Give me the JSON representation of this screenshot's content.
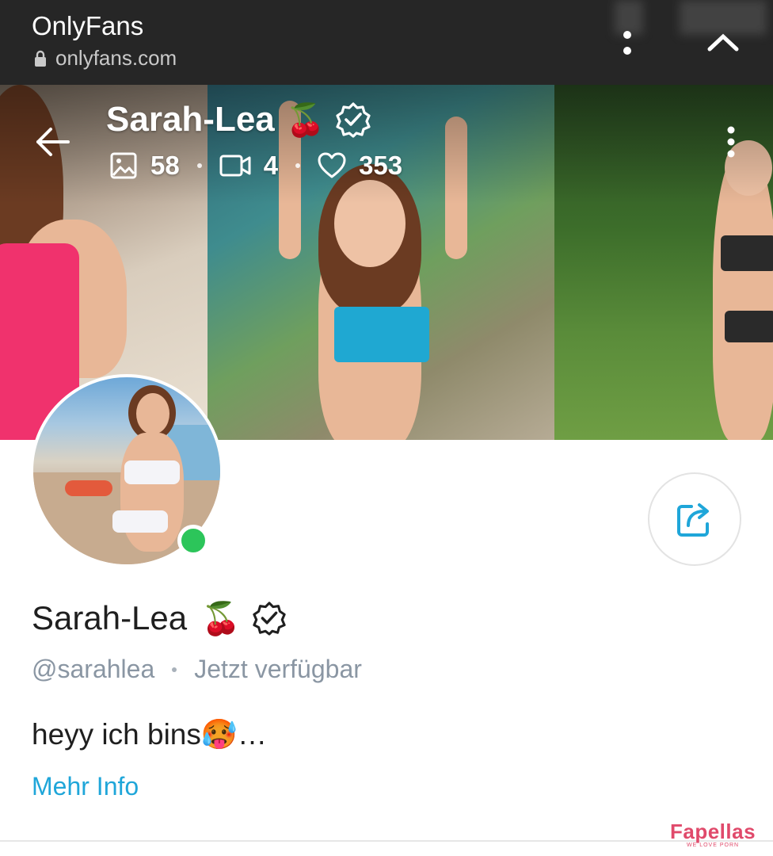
{
  "browser": {
    "title": "OnlyFans",
    "url": "onlyfans.com"
  },
  "cover": {
    "name": "Sarah-Lea",
    "emoji": "🍒",
    "stats": {
      "photos": "58",
      "videos": "4",
      "likes": "353"
    }
  },
  "profile": {
    "name": "Sarah-Lea",
    "emoji": "🍒",
    "handle": "@sarahlea",
    "status": "Jetzt verfügbar",
    "bio": "heyy ich bins🥵…",
    "more_info": "Mehr Info"
  },
  "watermark": {
    "brand": "Fapellas",
    "tagline": "WE LOVE PORN"
  },
  "colors": {
    "accent": "#1fa6d9",
    "online": "#2cc55a",
    "browser_bar": "#262626"
  },
  "icons": [
    "lock-icon",
    "more-vert-icon",
    "chevron-up-icon",
    "back-arrow-icon",
    "verified-badge-icon",
    "image-icon",
    "video-icon",
    "heart-icon",
    "share-icon"
  ]
}
